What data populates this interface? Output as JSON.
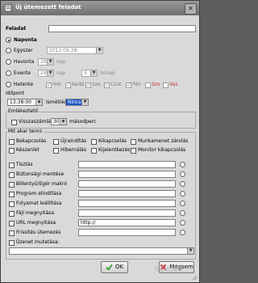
{
  "window": {
    "title": "Új ütemezett feladat",
    "close_glyph": "✕"
  },
  "task": {
    "label": "Feladat",
    "value": ""
  },
  "schedule": {
    "options": [
      {
        "label": "Naponta",
        "selected": true
      },
      {
        "label": "Egyszer",
        "selected": false
      },
      {
        "label": "Havonta",
        "selected": false
      },
      {
        "label": "Evente",
        "selected": false
      },
      {
        "label": "Hetente",
        "selected": false
      }
    ],
    "once_date": "2012.09.28.",
    "monthly": {
      "day": "28",
      "day_suffix": "nap"
    },
    "yearly": {
      "day": "28",
      "day_suffix": "nap",
      "month": "9",
      "month_suffix": "hónap"
    },
    "weekdays": [
      {
        "label": "Hét",
        "checked": true
      },
      {
        "label": "Kedd",
        "checked": true
      },
      {
        "label": "Sze",
        "checked": true
      },
      {
        "label": "Csüt",
        "checked": true
      },
      {
        "label": "Pén",
        "checked": true
      },
      {
        "label": "Szo",
        "checked": false
      },
      {
        "label": "Vas",
        "checked": false
      }
    ]
  },
  "time": {
    "label": "Időpont",
    "value": "13:38:00",
    "repeat_label": "Ismétlés:",
    "repeat_value": "Nincs"
  },
  "reminder": {
    "label": "Emlékeztető",
    "countdown_label": "Visszaszámlálás",
    "seconds": "30",
    "seconds_suffix": "másodperc"
  },
  "actions": {
    "label": "Mit akar tenni:",
    "power_options": [
      {
        "label": "Bekapcsolás"
      },
      {
        "label": "Újraindítás"
      },
      {
        "label": "Kikapcsolás"
      },
      {
        "label": "Munkamenet zárolás"
      },
      {
        "label": "Készenlét"
      },
      {
        "label": "Hibernálás"
      },
      {
        "label": "Kijelentkezés"
      },
      {
        "label": "Monitor kikapcsolás"
      }
    ],
    "items": [
      {
        "label": "Tisztás",
        "value": ""
      },
      {
        "label": "Biztonsági mentése",
        "value": ""
      },
      {
        "label": "Billentyű/Egér makró",
        "value": ""
      },
      {
        "label": "Program elindítása",
        "value": ""
      },
      {
        "label": "Folyamat leállítása",
        "value": ""
      },
      {
        "label": "Fájl megnyitása",
        "value": ""
      },
      {
        "label": "URL megnyitása",
        "value": "http://"
      },
      {
        "label": "Frissítés ütemezés",
        "value": ""
      },
      {
        "label": "Üzenet mutatása:",
        "value": ""
      }
    ]
  },
  "buttons": {
    "ok": "OK",
    "cancel": "Mégsem"
  },
  "watermark": "4TP.HU",
  "colors": {
    "accent": "#000080",
    "ok_check": "#2b9a2b",
    "cancel_x": "#c8202a"
  }
}
